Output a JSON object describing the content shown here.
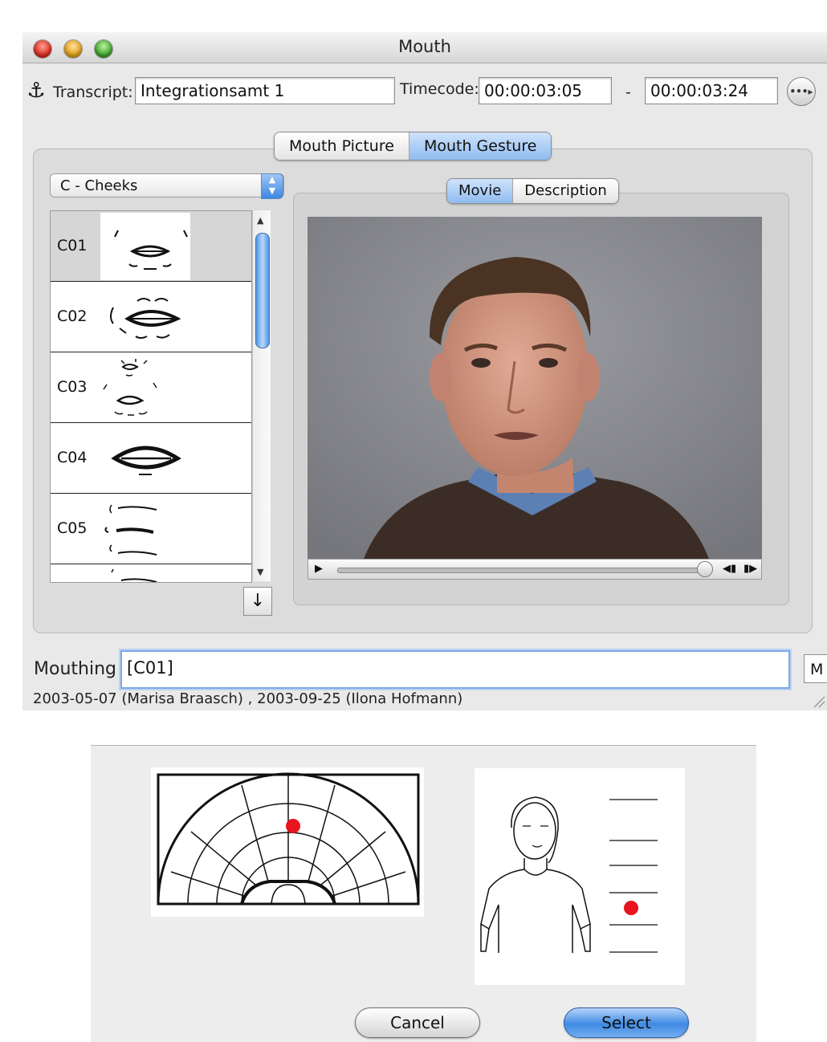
{
  "window": {
    "title": "Mouth",
    "transcript_label": "Transcript:",
    "transcript_value": "Integrationsamt 1",
    "timecode_label": "Timecode:",
    "timecode_start": "00:00:03:05",
    "timecode_separator": "-",
    "timecode_end": "00:00:03:24"
  },
  "tabs": {
    "main": [
      {
        "label": "Mouth Picture",
        "selected": false
      },
      {
        "label": "Mouth Gesture",
        "selected": true
      }
    ],
    "view": [
      {
        "label": "Movie",
        "selected": true
      },
      {
        "label": "Description",
        "selected": false
      }
    ]
  },
  "category_popup": {
    "value": "C - Cheeks"
  },
  "gesture_list": {
    "items": [
      {
        "code": "C01",
        "selected": true
      },
      {
        "code": "C02",
        "selected": false
      },
      {
        "code": "C03",
        "selected": false
      },
      {
        "code": "C04",
        "selected": false
      },
      {
        "code": "C05",
        "selected": false
      }
    ],
    "down_button": "↓"
  },
  "mouthing": {
    "label": "Mouthing",
    "value": "[C01]",
    "side_button": "M"
  },
  "credits": "2003-05-07 (Marisa Braasch) , 2003-09-25 (Ilona Hofmann)",
  "dialog": {
    "cancel_label": "Cancel",
    "select_label": "Select"
  },
  "colors": {
    "accent": "#8fbcf0",
    "marker": "#e8141e"
  },
  "icons": [
    "anchor-icon",
    "more-options-icon",
    "play-icon",
    "step-back-icon",
    "step-forward-icon",
    "down-arrow-icon"
  ]
}
